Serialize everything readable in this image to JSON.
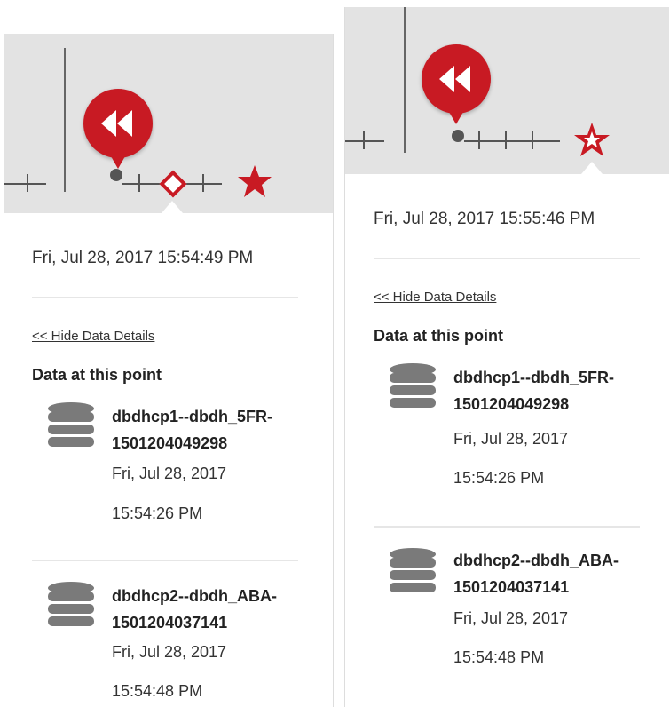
{
  "colors": {
    "accent": "#c81a23",
    "timeline_bg": "#e3e3e3",
    "text": "#333333"
  },
  "icons": {
    "rewind": "rewind-icon",
    "database": "database-icon",
    "star": "star-icon",
    "diamond": "diamond-marker-icon"
  },
  "panels": [
    {
      "timestamp": "Fri, Jul 28, 2017 15:54:49 PM",
      "hide_link": "<< Hide Data Details",
      "section_title": "Data at this point",
      "items": [
        {
          "name_line1": "dbdhcp1--dbdh_5FR-",
          "name_line2": "1501204049298",
          "date": "Fri, Jul 28, 2017",
          "time": "15:54:26 PM"
        },
        {
          "name_line1": "dbdhcp2--dbdh_ABA-",
          "name_line2": "1501204037141",
          "date": "Fri, Jul 28, 2017",
          "time": "15:54:48 PM"
        }
      ]
    },
    {
      "timestamp": "Fri, Jul 28, 2017 15:55:46 PM",
      "hide_link": "<< Hide Data Details",
      "section_title": "Data at this point",
      "items": [
        {
          "name_line1": "dbdhcp1--dbdh_5FR-",
          "name_line2": "1501204049298",
          "date": "Fri, Jul 28, 2017",
          "time": "15:54:26 PM"
        },
        {
          "name_line1": "dbdhcp2--dbdh_ABA-",
          "name_line2": "1501204037141",
          "date": "Fri, Jul 28, 2017",
          "time": "15:54:48 PM"
        }
      ]
    }
  ]
}
